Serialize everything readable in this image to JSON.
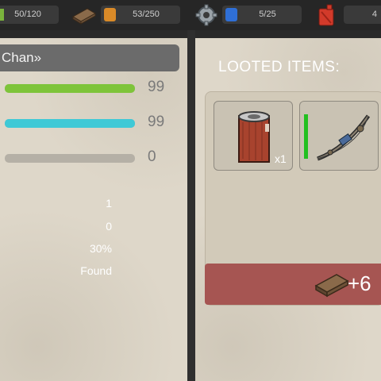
{
  "topbar": {
    "resource_1": {
      "value": "50/120",
      "color": "#7ab33c"
    },
    "resource_2": {
      "value": "53/250",
      "icon": "wood-plank-icon",
      "badge_icon": "orange-box-icon"
    },
    "resource_3": {
      "value": "5/25",
      "icon": "gear-icon",
      "badge_icon": "blue-box-icon"
    },
    "resource_4": {
      "value": "4",
      "icon": "fuel-canister-icon"
    }
  },
  "character": {
    "name": "Chan»",
    "bars": [
      {
        "color": "#7ec43a",
        "value": "99",
        "fill": 1.0
      },
      {
        "color": "#3fc9d6",
        "value": "99",
        "fill": 1.0
      },
      {
        "color": "#9a958c",
        "value": "0",
        "fill": 0.0
      }
    ],
    "stats": [
      "1",
      "0",
      "30%",
      "Found"
    ]
  },
  "loot": {
    "title": "LOOTED ITEMS:",
    "items": [
      {
        "icon": "leather-roll-icon",
        "count": "x1"
      },
      {
        "icon": "crossbow-icon"
      }
    ],
    "bonus": {
      "icon": "wood-plank-icon",
      "text": "+6"
    }
  }
}
